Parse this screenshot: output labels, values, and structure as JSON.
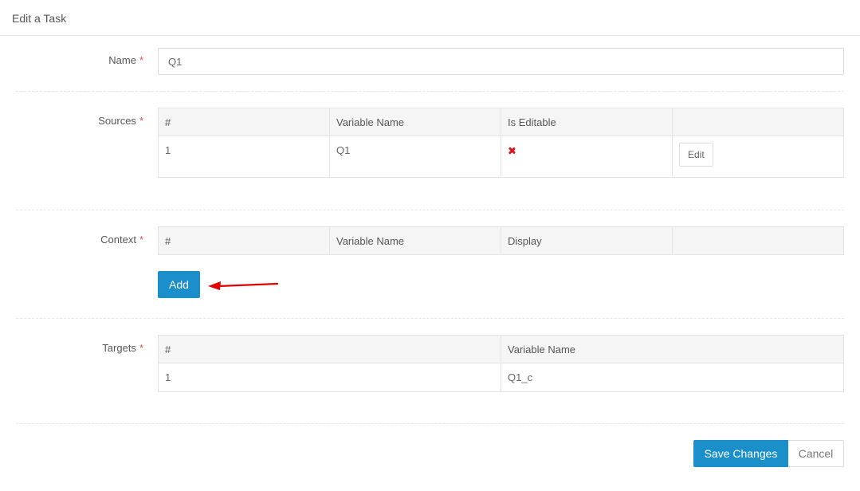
{
  "header": {
    "title": "Edit a Task"
  },
  "form": {
    "required_mark": "*",
    "name": {
      "label": "Name",
      "value": "Q1"
    },
    "sources": {
      "label": "Sources",
      "columns": [
        "#",
        "Variable Name",
        "Is Editable",
        ""
      ],
      "rows": [
        {
          "index": "1",
          "variable": "Q1",
          "editable_icon": "close-icon",
          "action": "Edit"
        }
      ]
    },
    "context": {
      "label": "Context",
      "columns": [
        "#",
        "Variable Name",
        "Display",
        ""
      ],
      "add_label": "Add"
    },
    "targets": {
      "label": "Targets",
      "columns": [
        "#",
        "Variable Name"
      ],
      "rows": [
        {
          "index": "1",
          "variable": "Q1_c"
        }
      ]
    }
  },
  "footer": {
    "save_label": "Save Changes",
    "cancel_label": "Cancel"
  },
  "colors": {
    "primary": "#1a8fc9",
    "required": "#d9534f",
    "error_icon": "#d9181e",
    "annotation_arrow": "#e00000"
  },
  "annotation": {
    "icon": "arrow-left-icon"
  }
}
